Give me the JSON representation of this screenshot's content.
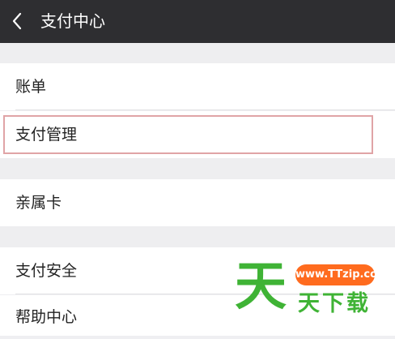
{
  "header": {
    "title": "支付中心",
    "back_icon": "chevron-left-icon"
  },
  "menu": {
    "bill": "账单",
    "payment_management": "支付管理",
    "family_card": "亲属卡",
    "payment_security": "支付安全",
    "help_center": "帮助中心"
  },
  "watermark": {
    "logo_char": "天",
    "url": "www.TTzip.com",
    "name": "天下载"
  },
  "colors": {
    "header_bg": "#2e2e31",
    "page_bg": "#efeff2",
    "highlight": "#e0a4a6",
    "watermark_green": "#3fb335",
    "watermark_orange": "#ff6b1e"
  }
}
